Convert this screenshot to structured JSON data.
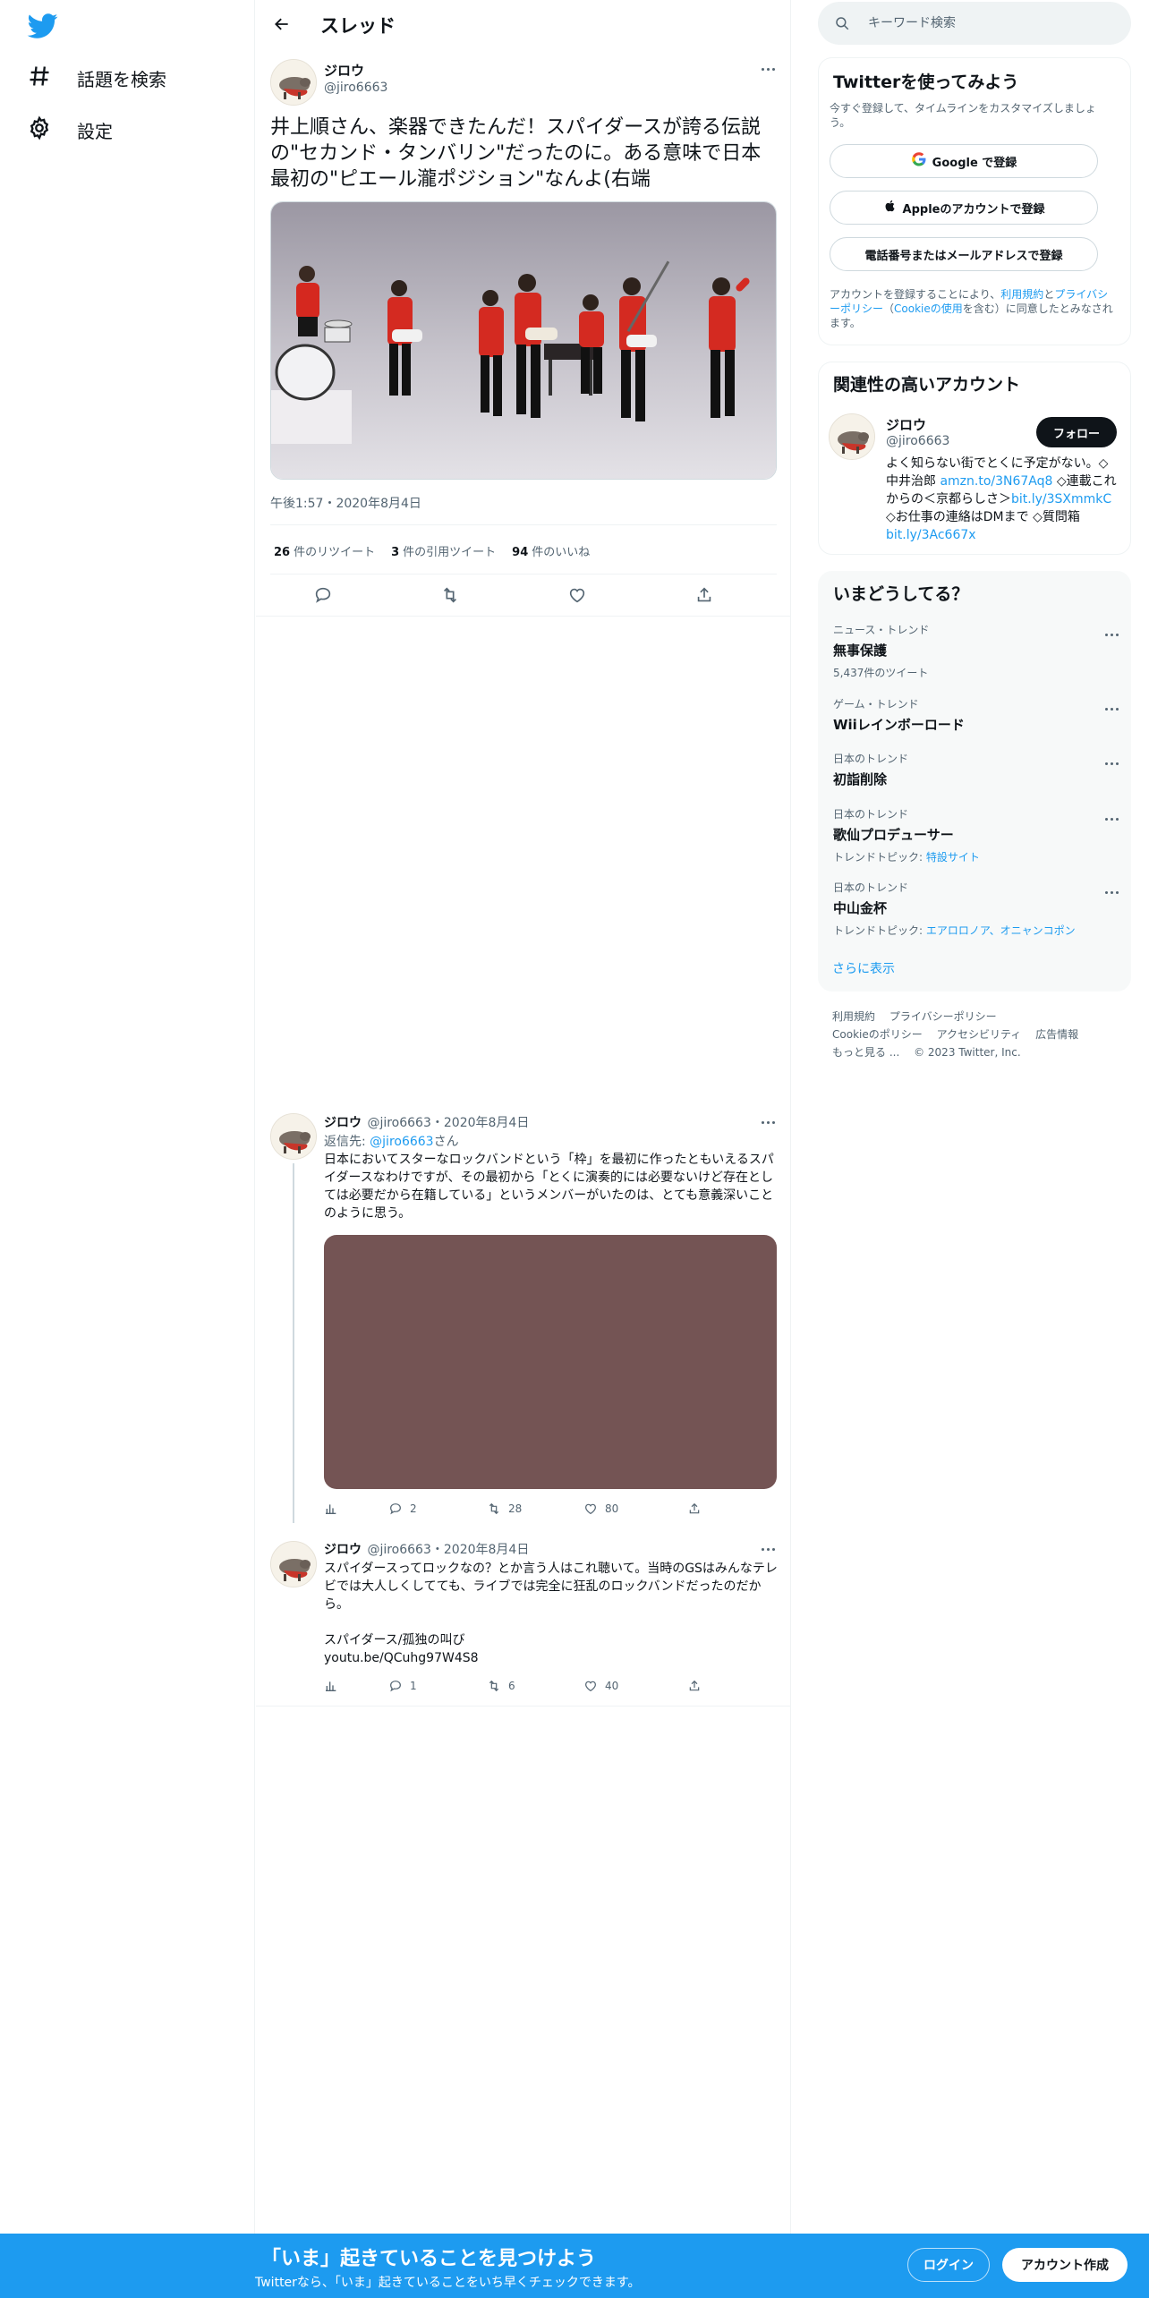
{
  "nav": {
    "explore_label": "話題を検索",
    "settings_label": "設定"
  },
  "header": {
    "title": "スレッド"
  },
  "main_tweet": {
    "name": "ジロウ",
    "handle": "@jiro6663",
    "text": "井上順さん、楽器できたんだ！スパイダースが誇る伝説の\"セカンド・タンバリン\"だったのに。ある意味で日本最初の\"ピエール瀧ポジション\"なんよ(右端",
    "time": "午後1:57・2020年8月4日",
    "retweets": {
      "count": "26",
      "label": "件のリツイート"
    },
    "quotes": {
      "count": "3",
      "label": "件の引用ツイート"
    },
    "likes": {
      "count": "94",
      "label": "件のいいね"
    }
  },
  "replies": [
    {
      "name": "ジロウ",
      "meta": "@jiro6663・2020年8月4日",
      "reply_prefix": "返信先:",
      "reply_to": "@jiro6663",
      "reply_suffix": "さん",
      "text": "日本においてスターなロックバンドという「枠」を最初に作ったともいえるスパイダースなわけですが、その最初から「とくに演奏的には必要ないけど存在としては必要だから在籍している」というメンバーがいたのは、とても意義深いことのように思う。",
      "media_color": "#745454",
      "replies": "2",
      "retweets": "28",
      "likes": "80"
    },
    {
      "name": "ジロウ",
      "meta": "@jiro6663・2020年8月4日",
      "text": "スパイダースってロックなの？とか言う人はこれ聴いて。当時のGSはみんなテレビでは大人しくしてても、ライブでは完全に狂乱のロックバンドだったのだから。",
      "song": "スパイダース/孤独の叫び",
      "link": "youtu.be/QCuhg97W4S8",
      "replies": "1",
      "retweets": "6",
      "likes": "40"
    }
  ],
  "search": {
    "placeholder": "キーワード検索"
  },
  "signup_card": {
    "title": "Twitterを使ってみよう",
    "subtitle": "今すぐ登録して、タイムラインをカスタマイズしましょう。",
    "google_label": "Google で登録",
    "apple_label": "Appleのアカウントで登録",
    "phone_label": "電話番号またはメールアドレスで登録",
    "note_prefix": "アカウントを登録することにより、",
    "note_terms": "利用規約",
    "note_and": "と",
    "note_privacy": "プライバシーポリシー",
    "note_cookie_open": "（",
    "note_cookie": "Cookieの使用",
    "note_suffix": "を含む）に同意したとみなされます。"
  },
  "related": {
    "title": "関連性の高いアカウント",
    "name": "ジロウ",
    "handle": "@jiro6663",
    "follow_label": "フォロー",
    "bio_1": "よく知らない街でとくに予定がない。◇中井治郎 ",
    "bio_link_1": "amzn.to/3N67Aq8",
    "bio_2": " ◇連載これからの＜京都らしさ＞",
    "bio_link_2": "bit.ly/3SXmmkC",
    "bio_3": " ◇お仕事の連絡はDMまで ◇質問箱",
    "bio_link_3": "bit.ly/3Ac667x"
  },
  "trends": {
    "title": "いまどうしてる？",
    "items": [
      {
        "category": "ニュース・トレンド",
        "name": "無事保護",
        "sub": "5,437件のツイート"
      },
      {
        "category": "ゲーム・トレンド",
        "name": "Wiiレインボーロード"
      },
      {
        "category": "日本のトレンド",
        "name": "初詣削除"
      },
      {
        "category": "日本のトレンド",
        "name": "歌仙プロデューサー",
        "sub_label": "トレンドトピック: ",
        "sub_link": "特設サイト"
      },
      {
        "category": "日本のトレンド",
        "name": "中山金杯",
        "sub_label": "トレンドトピック: ",
        "sub_link": "エアロロノア、オニャンコポン"
      }
    ],
    "show_more": "さらに表示"
  },
  "footer": {
    "terms": "利用規約",
    "privacy": "プライバシーポリシー",
    "cookie": "Cookieのポリシー",
    "accessibility": "アクセシビリティ",
    "ads": "広告情報",
    "more": "もっと見る ...",
    "copyright": "© 2023 Twitter, Inc."
  },
  "bottom_bar": {
    "title": "「いま」起きていることを見つけよう",
    "subtitle": "Twitterなら、「いま」起きていることをいち早くチェックできます。",
    "login_label": "ログイン",
    "signup_label": "アカウント作成"
  },
  "colors": {
    "accent": "#1d9bf0",
    "text": "#0f1419",
    "secondary": "#536471",
    "reply_media": "#745454"
  }
}
